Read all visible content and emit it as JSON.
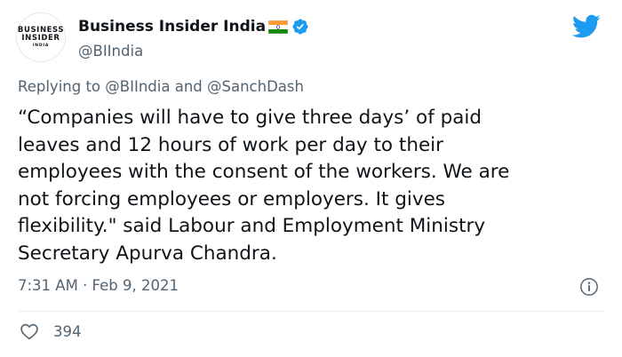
{
  "author": {
    "display_name": "Business Insider India",
    "handle": "@BIIndia",
    "avatar_lines": [
      "BUSINESS",
      "INSIDER",
      "INDIA"
    ],
    "verified": true,
    "flag": "india-flag"
  },
  "reply": {
    "prefix": "Replying to",
    "mention_1": "@BIIndia",
    "joiner": "and",
    "mention_2": "@SanchDash"
  },
  "tweet": {
    "text": "“Companies will have to give three days’ of paid\nleaves and 12 hours of work per day to their\nemployees with the consent of the workers. We are\nnot forcing employees or employers. It gives\nflexibility.\" said Labour and Employment Ministry\nSecretary Apurva Chandra."
  },
  "meta": {
    "timestamp": "7:31 AM · Feb 9, 2021"
  },
  "stats": {
    "likes": "394"
  },
  "colors": {
    "twitter_blue": "#1d9bf0",
    "muted_text": "#536471",
    "primary_text": "#0f1419"
  },
  "icons": {
    "brand": "twitter-bird-icon",
    "verified": "verified-badge-icon",
    "info": "info-icon",
    "like": "heart-icon"
  }
}
